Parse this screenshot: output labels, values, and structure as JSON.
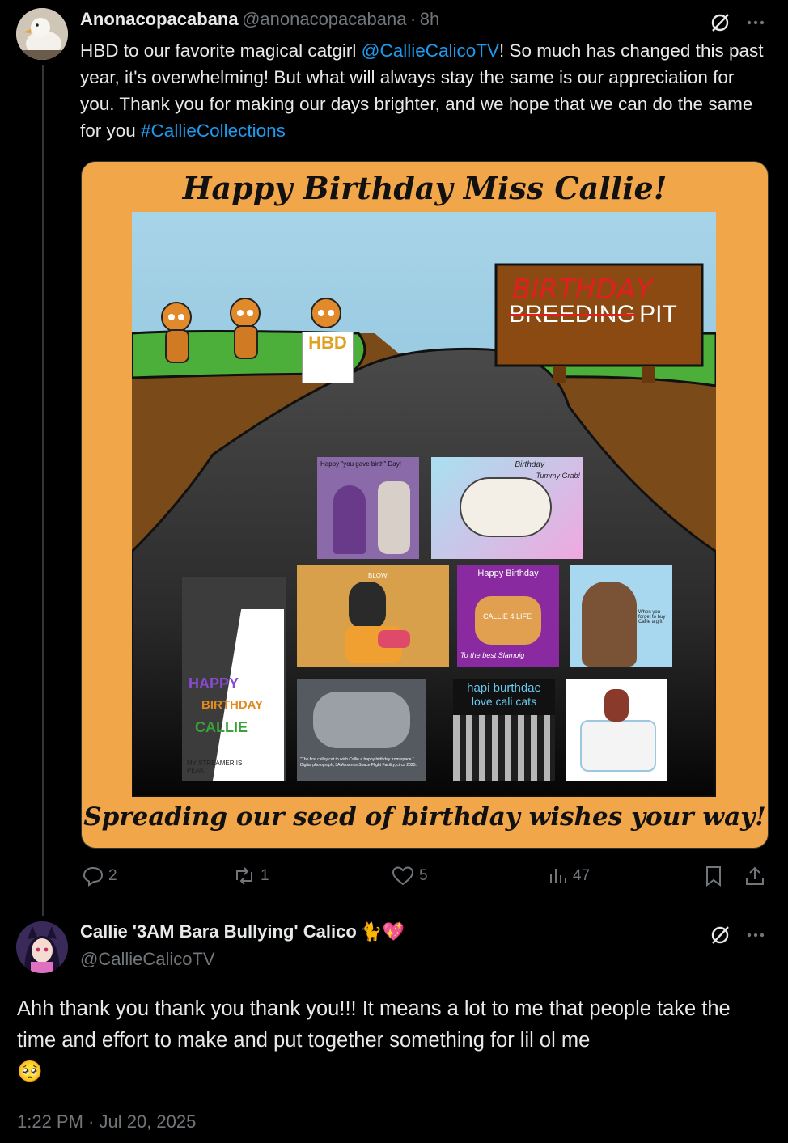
{
  "post1": {
    "display_name": "Anonacopacabana",
    "handle": "@anonacopacabana",
    "time": "8h",
    "separator": "·",
    "text_parts": [
      {
        "text": "HBD to our favorite magical catgirl ",
        "link": false
      },
      {
        "text": "@CallieCalicoTV",
        "link": true
      },
      {
        "text": "! So much has changed this past year, it's overwhelming! But what will always stay the same is our appreciation for you. Thank you for making our days brighter, and we hope that we can do the same for you ",
        "link": false
      },
      {
        "text": "#CallieCollections",
        "link": true
      }
    ],
    "image": {
      "top_banner": "Happy Birthday Miss Callie!",
      "bottom_banner": "Spreading our seed of birthday wishes your way!",
      "sign_new": "BIRTHDAY",
      "sign_old": "BREEDING",
      "sign_suffix": "PIT",
      "hbd_box": "HBD",
      "thumb_texts": {
        "t1": "Happy \"you gave birth\" Day!",
        "t2a": "Birthday",
        "t2b": "Tummy Grab!",
        "t3": "BLOW",
        "t4a": "Happy Birthday",
        "t4b": "CALLIE 4 LIFE",
        "t4c": "To the best Slampig",
        "t5": "When you forget to buy Callie a gift",
        "t6a": "HAPPY",
        "t6b": "BIRTHDAY",
        "t6c": "CALLIE",
        "t6d": "MY STREAMER IS PEAK!",
        "t7": "\"The first calley cat to wish Callie a happy birthday from space.\" Digital photograph, 3AMcosmos Space Flight Facility, circa 2025.",
        "t8a": "hapi burthdae",
        "t8b": "love cali cats"
      }
    },
    "stats": {
      "replies": "2",
      "reposts": "1",
      "likes": "5",
      "views": "47"
    }
  },
  "post2": {
    "display_name": "Callie '3AM Bara Bullying' Calico",
    "handle": "@CallieCalicoTV",
    "emoji": "🐈💖",
    "text": "Ahh thank you thank you thank you!!! It means a lot to me that people take the time and effort to make and put together something for lil ol me",
    "text_emoji": "🥺",
    "timestamp": "1:22 PM · Jul 20, 2025"
  },
  "colors": {
    "accent": "#1d9bf0",
    "muted": "#71767b",
    "frame": "#f2a64a"
  }
}
